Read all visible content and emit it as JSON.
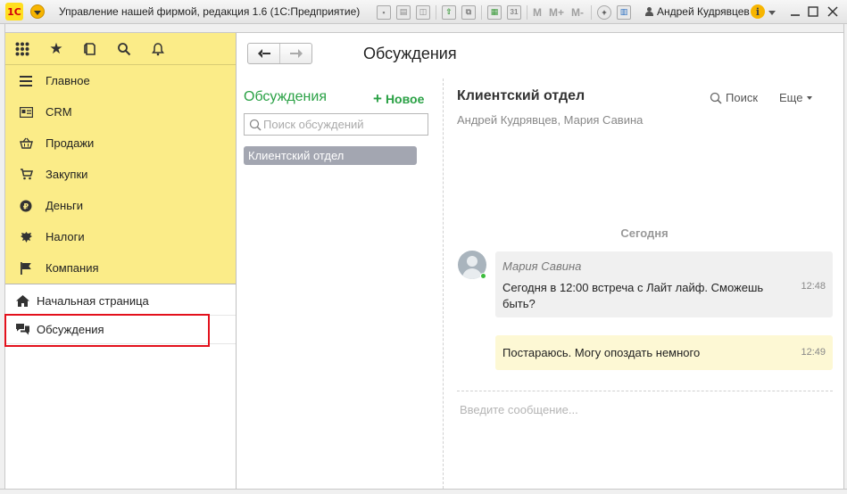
{
  "window": {
    "logo_text": "1С",
    "title": "Управление нашей фирмой, редакция 1.6  (1С:Предприятие)",
    "user": "Андрей Кудрявцев",
    "toolbar_letters": [
      "M",
      "M+",
      "M-"
    ],
    "calendar_day": "31"
  },
  "sidebar": {
    "sections": [
      {
        "label": "Главное",
        "icon": "list-icon"
      },
      {
        "label": "CRM",
        "icon": "contact-card-icon"
      },
      {
        "label": "Продажи",
        "icon": "basket-icon"
      },
      {
        "label": "Закупки",
        "icon": "cart-icon"
      },
      {
        "label": "Деньги",
        "icon": "ruble-icon"
      },
      {
        "label": "Налоги",
        "icon": "eagle-icon"
      },
      {
        "label": "Компания",
        "icon": "flag-icon"
      }
    ],
    "pages": [
      {
        "label": "Начальная страница",
        "icon": "home-icon"
      },
      {
        "label": "Обсуждения",
        "icon": "chat-icon"
      }
    ]
  },
  "main": {
    "page_title": "Обсуждения",
    "list": {
      "title": "Обсуждения",
      "new_label": "Новое",
      "search_placeholder": "Поиск обсуждений",
      "items": [
        "Клиентский отдел"
      ]
    },
    "conversation": {
      "title": "Клиентский отдел",
      "members": "Андрей Кудрявцев, Мария Савина",
      "search_label": "Поиск",
      "more_label": "Еще",
      "day_label": "Сегодня",
      "messages": [
        {
          "author": "Мария Савина",
          "text": "Сегодня в 12:00 встреча с Лайт лайф. Сможешь быть?",
          "time": "12:48",
          "own": false
        },
        {
          "author": "",
          "text": "Постараюсь. Могу опоздать немного",
          "time": "12:49",
          "own": true
        }
      ],
      "input_placeholder": "Введите сообщение..."
    }
  },
  "colors": {
    "accent_green": "#2aa145",
    "sidebar_yellow": "#fbec88",
    "highlight_red": "#e3111c",
    "selected_item": "#a3a6b1",
    "own_message": "#fdf8d4"
  }
}
